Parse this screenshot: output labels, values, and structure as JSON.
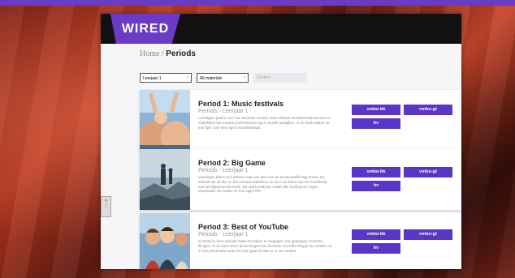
{
  "header": {
    "logo_text": "WIRED"
  },
  "breadcrumb": {
    "home": "Home",
    "separator": "/",
    "current": "Periods"
  },
  "filters": {
    "level_value": "Leerjaar 1",
    "materials_value": "All materials",
    "search_placeholder": "Zoeken"
  },
  "side_tab": {
    "icon_top": "»",
    "icon_bottom": "⋮"
  },
  "cards": [
    {
      "title": "Period 1: Music festivals",
      "subtitle": "Periods - Leerjaar 1",
      "description": "Leerlingen praten over hun favoriete muziek, leren elkaars muzieksmaak kennen en ontdekken hoe muziek professionals tegen muziek aankijken. In de boek maken ze een flyer voor een eigen muziekfestival.",
      "buttons": [
        "vmbo-bk",
        "vmbo-gt",
        "hv"
      ]
    },
    {
      "title": "Period 2: Big Game",
      "subtitle": "Periods - Leerjaar 1",
      "description": "Leerlingen kijken en luisteren naar een deel van de avonturenfilm Big Game. De inhoud van de film en het verhaal ontdekken ze door het lezen van een hoofdstuk van het bijbehorende boek. Van dat hoofdstuk maakt elke leerling een eigen storyboard. Zo maken ze hun eigen film.",
      "buttons": [
        "vmbo-bk",
        "vmbo-gt",
        "hv"
      ]
    },
    {
      "title": "Period 3: Best of YouTube",
      "subtitle": "Periods - Leerjaar 1",
      "description": "Centraal in deze periode staan het kijken en begrijpen van (grappige) YouTube-filmpjes. In de boek lezen de leerlingen hun favoriete YouTube-filmpje en vertellen ze in een presentatie waar het over gaat en wat ze er van vinden.",
      "buttons": [
        "vmbo-bk",
        "vmbo-gt",
        "hv"
      ]
    }
  ],
  "colors": {
    "brand": "#6a3bc4",
    "button": "#5a36c8",
    "header": "#111111"
  }
}
